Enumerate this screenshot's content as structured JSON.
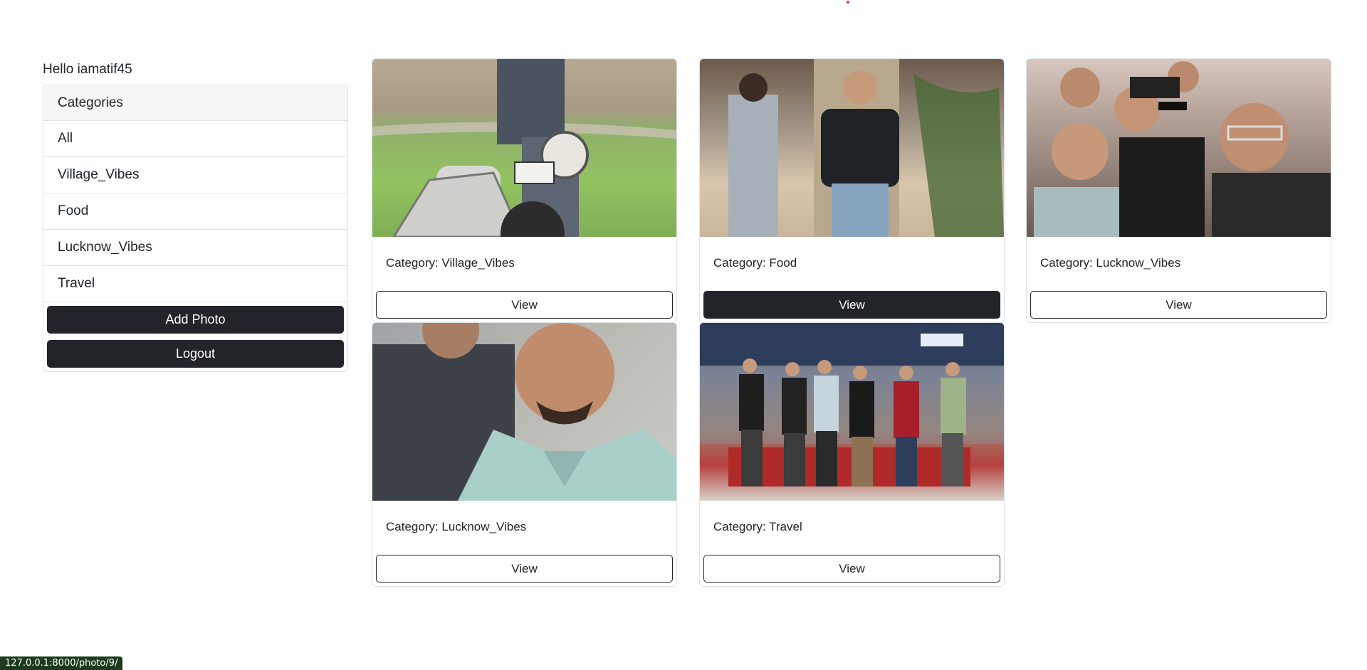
{
  "greeting": "Hello iamatif45",
  "sidebar": {
    "header": "Categories",
    "items": [
      {
        "label": "All"
      },
      {
        "label": "Village_Vibes"
      },
      {
        "label": "Food"
      },
      {
        "label": "Lucknow_Vibes"
      },
      {
        "label": "Travel"
      }
    ],
    "add_photo_label": "Add Photo",
    "logout_label": "Logout"
  },
  "photos": [
    {
      "caption": "Category: Village_Vibes",
      "button": "View"
    },
    {
      "caption": "Category: Food",
      "button": "View"
    },
    {
      "caption": "Category: Lucknow_Vibes",
      "button": "View"
    },
    {
      "caption": "Category: Lucknow_Vibes",
      "button": "View"
    },
    {
      "caption": "Category: Travel",
      "button": "View"
    }
  ],
  "status_bar": {
    "url": "127.0.0.1:8000/photo/9/"
  },
  "colors": {
    "primary_dark": "#212529",
    "border": "#dee2e6",
    "accent_dot": "#dc3545"
  }
}
